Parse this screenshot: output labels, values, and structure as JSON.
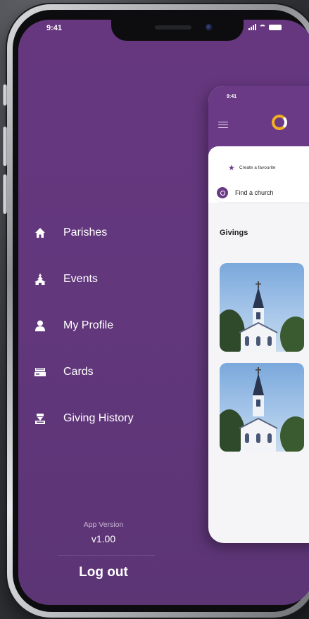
{
  "status_bar": {
    "time": "9:41"
  },
  "menu": {
    "items": [
      {
        "label": "Parishes",
        "icon": "home-icon"
      },
      {
        "label": "Events",
        "icon": "church-icon"
      },
      {
        "label": "My Profile",
        "icon": "user-icon"
      },
      {
        "label": "Cards",
        "icon": "card-icon"
      },
      {
        "label": "Giving History",
        "icon": "giving-history-icon"
      }
    ],
    "app_version_label": "App Version",
    "app_version": "v1.00",
    "logout_label": "Log out"
  },
  "preview": {
    "time": "9:41",
    "favourite_text": "Create a favourite",
    "search_text": "Find a church",
    "section_title": "Givings"
  },
  "colors": {
    "drawer_bg": "#62377c",
    "accent": "#6b3a86",
    "logo_accent": "#f2b01e"
  }
}
